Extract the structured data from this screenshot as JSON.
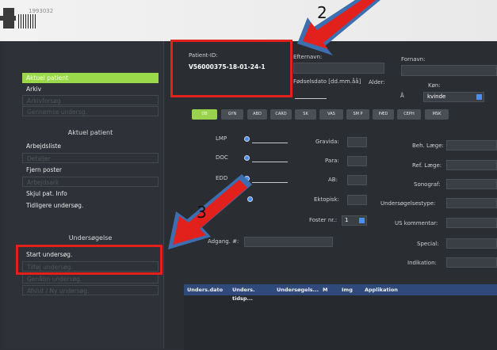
{
  "header": {
    "serial": "1993032"
  },
  "left_panel": {
    "items_top": [
      {
        "label": "Aktuel patient",
        "state": "active"
      },
      {
        "label": "Arkiv",
        "state": "normal"
      },
      {
        "label": "Arkivforsøg",
        "state": "disabled"
      },
      {
        "label": "Gennemse undersg.",
        "state": "disabled"
      }
    ],
    "section1_title": "Aktuel patient",
    "items_mid": [
      {
        "label": "Arbejdsliste",
        "state": "normal"
      },
      {
        "label": "Detaljer",
        "state": "disabled"
      },
      {
        "label": "Fjern poster",
        "state": "normal"
      },
      {
        "label": "Arbejdsark",
        "state": "disabled"
      },
      {
        "label": "Skjul pat. Info",
        "state": "normal"
      },
      {
        "label": "Tidligere undersøg.",
        "state": "normal"
      }
    ],
    "section2_title": "Undersøgelse",
    "items_bottom": [
      {
        "label": "Start undersøg.",
        "state": "normal"
      },
      {
        "label": "Tilføj undersøg.",
        "state": "disabled"
      },
      {
        "label": "Genåbn undersøg.",
        "state": "disabled"
      },
      {
        "label": "Afslut / Ny undersøg.",
        "state": "disabled"
      }
    ]
  },
  "patient": {
    "id_label": "Patient-ID:",
    "id_value": "V56000375-18-01-24-1",
    "surname_label": "Efternavn:",
    "firstname_label": "Fornavn:",
    "dob_label": "Fødselsdato [dd.mm.åå]",
    "age_label": "Alder:",
    "age_unit": "Å",
    "sex_label": "Køn:",
    "sex_value": "kvinde"
  },
  "tabs": [
    "OB",
    "GYN",
    "ABD",
    "CARD",
    "SK",
    "VAS",
    "SM P",
    "PÆD",
    "CEPH",
    "MSK"
  ],
  "ob_form": {
    "lmp_label": "LMP",
    "doc_label": "DOC",
    "edd_label": "EDD",
    "gravida_label": "Gravida:",
    "para_label": "Para:",
    "ab_label": "AB:",
    "ektopisk_label": "Ektopisk:",
    "foster_label": "Foster nr.:",
    "foster_value": "1",
    "adgang_label": "Adgang. #:",
    "beh_laege_label": "Beh. Læge:",
    "ref_laege_label": "Ref. Læge:",
    "sonograf_label": "Sonograf:",
    "undersoegelsestype_label": "Undersøgelsestype:",
    "us_kommentar_label": "US kommentar:",
    "special_label": "Special:",
    "indikation_label": "Indikation:"
  },
  "table": {
    "headers": [
      "Unders.dato",
      "Unders. tidsp...",
      "Undersøgels...",
      "M",
      "Img",
      "Applikation"
    ]
  },
  "callouts": {
    "two": "2",
    "three": "3"
  },
  "colors": {
    "accent_green": "#9bd94a",
    "highlight_red": "#e2201c",
    "arrow_blue": "#3d6fb0"
  }
}
